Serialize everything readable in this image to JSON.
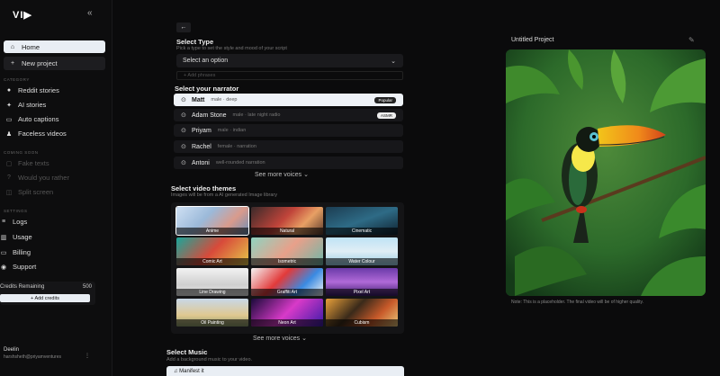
{
  "app": {
    "logo": "VI▶",
    "collapse_icon": "«"
  },
  "sidebar": {
    "home": "Home",
    "new_project": "New project",
    "category_label": "CATEGORY",
    "categories": [
      "Reddit stories",
      "AI stories",
      "Auto captions",
      "Faceless videos"
    ],
    "coming_soon_label": "COMING SOON",
    "coming_soon": [
      "Fake texts",
      "Would you rather",
      "Split screen"
    ],
    "settings_label": "SETTINGS",
    "settings": [
      "Logs",
      "Usage",
      "Billing",
      "Support"
    ],
    "credits_label": "Credits Remaining",
    "credits_value": "500",
    "add_credits": "+ Add credits",
    "user_name": "Deelin",
    "user_email": "harshsheth@priyamventures"
  },
  "main": {
    "select_type_title": "Select Type",
    "select_type_sub": "Pick a type to set the style and mood of your script",
    "select_placeholder": "Select an option",
    "add_phrases": "+ Add phrases",
    "narrator_title": "Select your narrator",
    "voices": [
      {
        "name": "Matt",
        "desc": "male · deep",
        "badge": "Popular",
        "selected": true
      },
      {
        "name": "Adam Stone",
        "desc": "male · late night radio",
        "badge": "ASMR",
        "selected": false
      },
      {
        "name": "Priyam",
        "desc": "male · indian",
        "badge": "",
        "selected": false
      },
      {
        "name": "Rachel",
        "desc": "female · narration",
        "badge": "",
        "selected": false
      },
      {
        "name": "Antoni",
        "desc": "well-rounded narration",
        "badge": "",
        "selected": false
      }
    ],
    "see_more_voices": "See more voices ⌄",
    "themes_title": "Select video themes",
    "themes_sub": "Images will be from a AI generated Image library",
    "themes": [
      "Anime",
      "Natural",
      "Cinematic",
      "Comic Art",
      "Isometric",
      "Water Colour",
      "Line Drawing",
      "Graffiti Art",
      "Pixel Art",
      "Oil Painting",
      "Neon Art",
      "Cubism"
    ],
    "see_more_themes": "See more voices ⌄",
    "music_title": "Select Music",
    "music_sub": "Add a background music to your video.",
    "music_selected": "♫ Manifest it"
  },
  "preview": {
    "title": "Untitled Project",
    "note": "Note: This is a placeholder. The final video will be of higher quality."
  }
}
